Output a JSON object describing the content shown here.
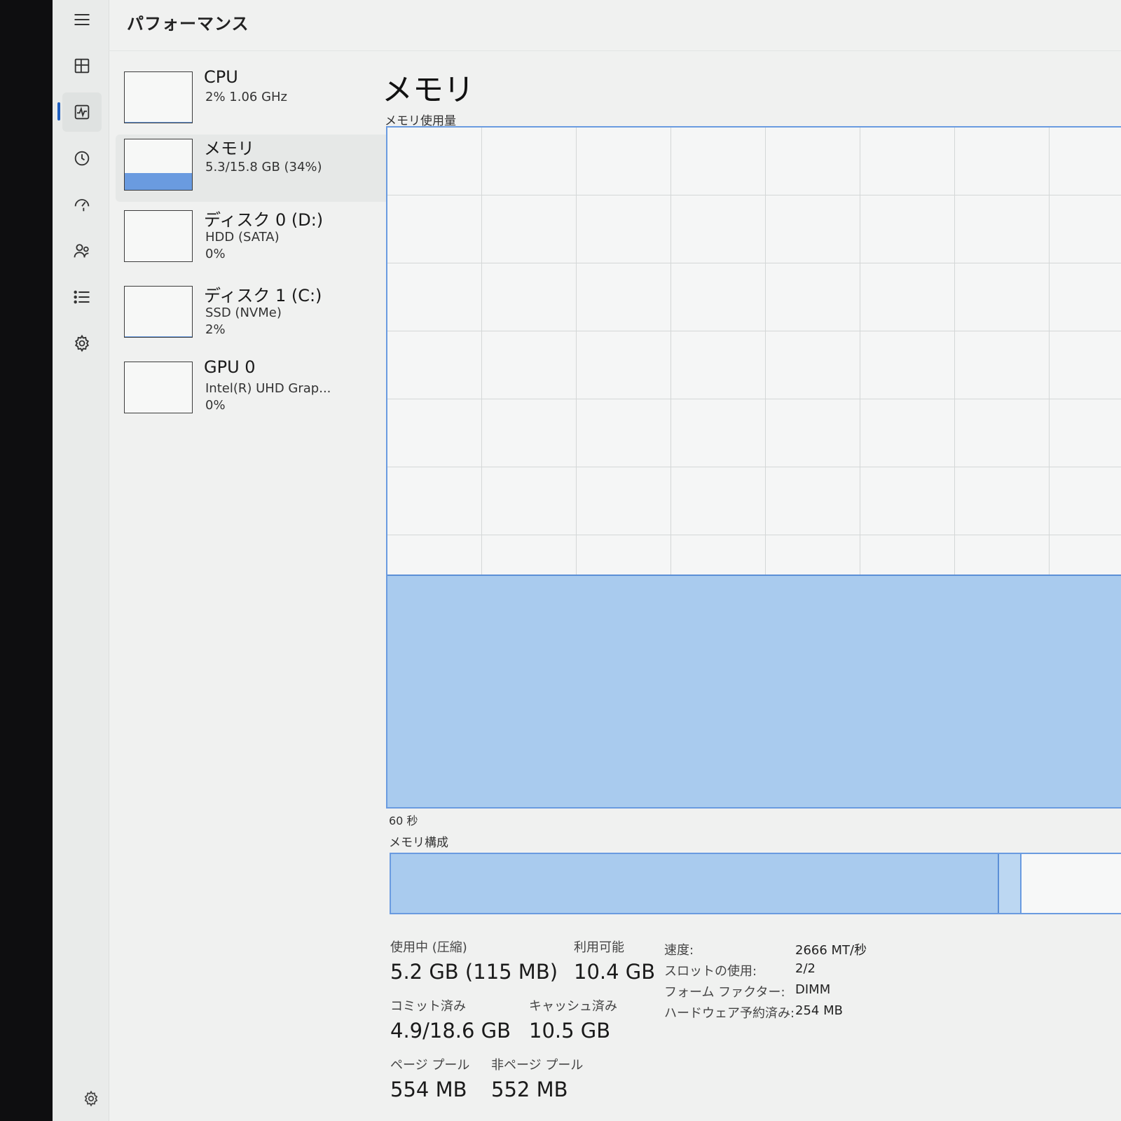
{
  "window": {
    "title": "パフォーマンス"
  },
  "nav": {
    "items": [
      {
        "name": "menu",
        "icon": "hamburger-icon"
      },
      {
        "name": "processes",
        "icon": "processes-icon"
      },
      {
        "name": "performance",
        "icon": "performance-icon",
        "active": true
      },
      {
        "name": "app-history",
        "icon": "history-icon"
      },
      {
        "name": "startup-apps",
        "icon": "startup-icon"
      },
      {
        "name": "users",
        "icon": "users-icon"
      },
      {
        "name": "details",
        "icon": "list-icon"
      },
      {
        "name": "services",
        "icon": "services-icon"
      }
    ],
    "settings_icon": "settings-icon"
  },
  "devices": [
    {
      "name": "CPU",
      "line1": "2%  1.06 GHz",
      "line2": "",
      "usage_fraction": 0.02
    },
    {
      "name": "メモリ",
      "line1": "5.3/15.8 GB (34%)",
      "line2": "",
      "usage_fraction": 0.34,
      "selected": true
    },
    {
      "name": "ディスク 0 (D:)",
      "line1": "HDD (SATA)",
      "line2": "0%",
      "usage_fraction": 0.0
    },
    {
      "name": "ディスク 1 (C:)",
      "line1": "SSD (NVMe)",
      "line2": "2%",
      "usage_fraction": 0.02
    },
    {
      "name": "GPU 0",
      "line1": "Intel(R) UHD Grap...",
      "line2": "0%",
      "usage_fraction": 0.0
    }
  ],
  "main": {
    "title": "メモリ",
    "usage_chart_label": "メモリ使用量",
    "time_label": "60 秒",
    "composition_label": "メモリ構成",
    "usage_fraction": 0.34,
    "composition": {
      "in_use_fraction": 0.82,
      "modified_fraction": 0.028
    }
  },
  "stats": {
    "in_use_label": "使用中 (圧縮)",
    "in_use_value": "5.2 GB (115 MB)",
    "available_label": "利用可能",
    "available_value": "10.4 GB",
    "committed_label": "コミット済み",
    "committed_value": "4.9/18.6 GB",
    "cached_label": "キャッシュ済み",
    "cached_value": "10.5 GB",
    "paged_pool_label": "ページ プール",
    "paged_pool_value": "554 MB",
    "nonpaged_pool_label": "非ページ プール",
    "nonpaged_pool_value": "552 MB"
  },
  "specs": [
    {
      "key": "速度:",
      "value": "2666 MT/秒"
    },
    {
      "key": "スロットの使用:",
      "value": "2/2"
    },
    {
      "key": "フォーム ファクター:",
      "value": "DIMM"
    },
    {
      "key": "ハードウェア予約済み:",
      "value": "254 MB"
    }
  ],
  "colors": {
    "accent": "#1f5fbf",
    "memory_line": "#5b8fd6",
    "memory_fill": "#a9cbee"
  }
}
